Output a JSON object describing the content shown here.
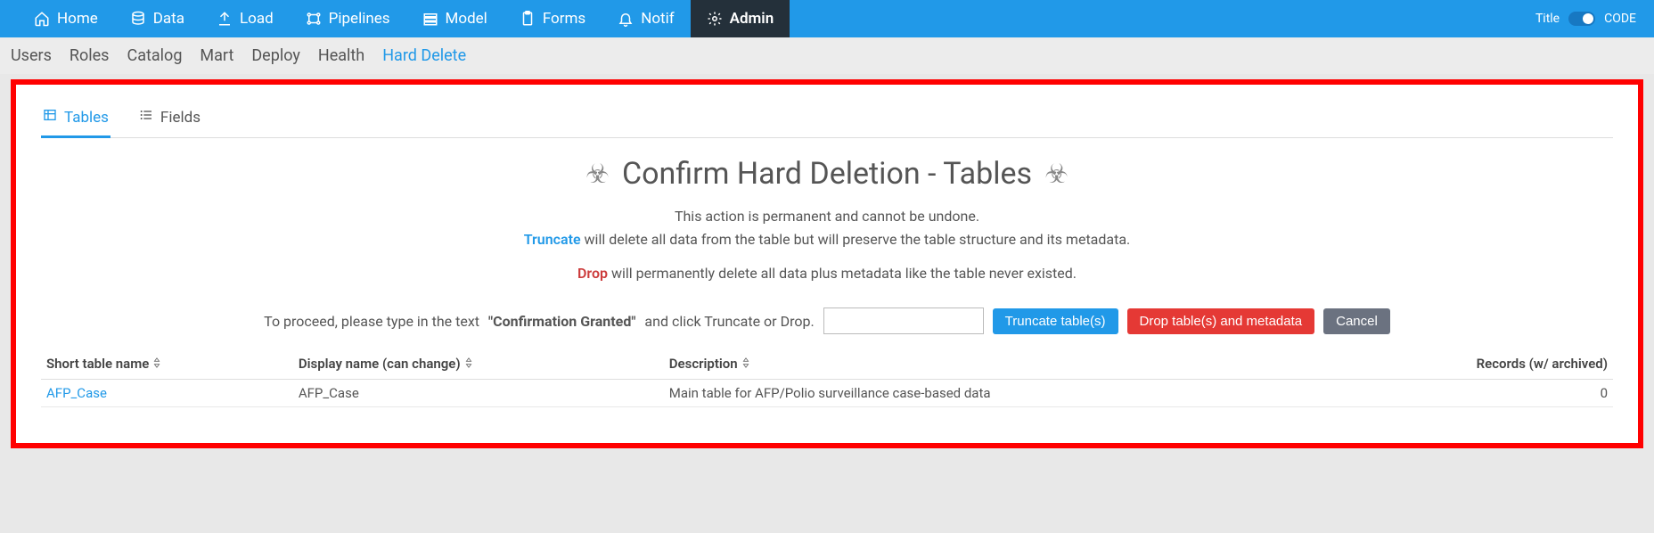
{
  "topnav": {
    "items": [
      {
        "label": "Home",
        "icon": "home-icon"
      },
      {
        "label": "Data",
        "icon": "database-icon"
      },
      {
        "label": "Load",
        "icon": "upload-icon"
      },
      {
        "label": "Pipelines",
        "icon": "pipeline-icon"
      },
      {
        "label": "Model",
        "icon": "model-icon"
      },
      {
        "label": "Forms",
        "icon": "clipboard-icon"
      },
      {
        "label": "Notif",
        "icon": "bell-icon"
      },
      {
        "label": "Admin",
        "icon": "gear-icon"
      }
    ],
    "right_title": "Title",
    "right_code": "CODE"
  },
  "subnav": {
    "items": [
      "Users",
      "Roles",
      "Catalog",
      "Mart",
      "Deploy",
      "Health",
      "Hard Delete"
    ],
    "active": "Hard Delete"
  },
  "tabs": {
    "tables": "Tables",
    "fields": "Fields"
  },
  "page": {
    "title": "Confirm Hard Deletion - Tables",
    "warn_permanent": "This action is permanent and cannot be undone.",
    "truncate_word": "Truncate",
    "truncate_rest": " will delete all data from the table but will preserve the table structure and its metadata.",
    "drop_word": "Drop",
    "drop_rest": " will permanently delete all data plus metadata like the table never existed.",
    "confirm_prefix": "To proceed, please type in the text ",
    "confirm_bold": "\"Confirmation Granted\"",
    "confirm_suffix": " and click Truncate or Drop.",
    "btn_truncate": "Truncate table(s)",
    "btn_drop": "Drop table(s) and metadata",
    "btn_cancel": "Cancel"
  },
  "table": {
    "headers": {
      "short": "Short table name",
      "display": "Display name (can change)",
      "desc": "Description",
      "records": "Records (w/ archived)"
    },
    "rows": [
      {
        "short": "AFP_Case",
        "display": "AFP_Case",
        "desc": "Main table for AFP/Polio surveillance case-based data",
        "records": "0"
      }
    ]
  }
}
